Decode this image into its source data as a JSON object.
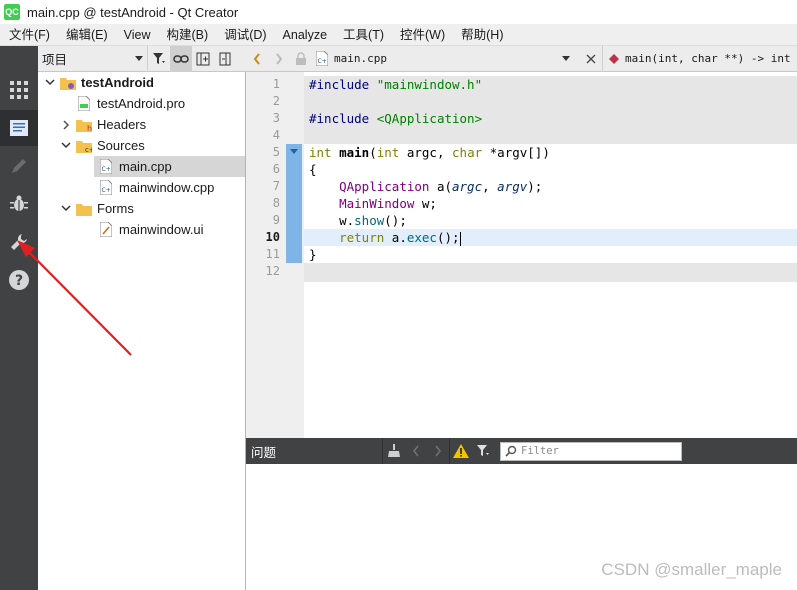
{
  "window": {
    "logo_text": "QC",
    "title": "main.cpp @ testAndroid - Qt Creator"
  },
  "menubar": [
    "文件(F)",
    "编辑(E)",
    "View",
    "构建(B)",
    "调试(D)",
    "Analyze",
    "工具(T)",
    "控件(W)",
    "帮助(H)"
  ],
  "modes": [
    "welcome-grid-icon",
    "edit-document-icon",
    "design-pencil-icon",
    "debug-bug-icon",
    "projects-wrench-icon",
    "help-question-icon"
  ],
  "project_pane": {
    "combo_label": "项目",
    "tree": [
      {
        "label": "testAndroid",
        "bold": true,
        "arrow": "down",
        "icon": "project-folder-icon",
        "depth": 0
      },
      {
        "label": "testAndroid.pro",
        "bold": false,
        "arrow": "",
        "icon": "pro-file-icon",
        "depth": 1
      },
      {
        "label": "Headers",
        "bold": false,
        "arrow": "right",
        "icon": "headers-folder-icon",
        "depth": 1
      },
      {
        "label": "Sources",
        "bold": false,
        "arrow": "down",
        "icon": "sources-folder-icon",
        "depth": 1
      },
      {
        "label": "main.cpp",
        "bold": false,
        "arrow": "",
        "icon": "cpp-file-icon",
        "depth": 2,
        "selected": true
      },
      {
        "label": "mainwindow.cpp",
        "bold": false,
        "arrow": "",
        "icon": "cpp-file-icon",
        "depth": 2
      },
      {
        "label": "Forms",
        "bold": false,
        "arrow": "down",
        "icon": "forms-folder-icon",
        "depth": 1
      },
      {
        "label": "mainwindow.ui",
        "bold": false,
        "arrow": "",
        "icon": "ui-file-icon",
        "depth": 2
      }
    ]
  },
  "editor": {
    "file_name": "main.cpp",
    "symbol": "main(int, char **) -> int",
    "current_line": 10,
    "line_numbers": [
      "1",
      "2",
      "3",
      "4",
      "5",
      "6",
      "7",
      "8",
      "9",
      "10",
      "11",
      "12"
    ],
    "code": [
      "#include \"mainwindow.h\"",
      "",
      "#include <QApplication>",
      "",
      "int main(int argc, char *argv[])",
      "{",
      "    QApplication a(argc, argv);",
      "    MainWindow w;",
      "    w.show();",
      "    return a.exec();",
      "}",
      ""
    ]
  },
  "issues": {
    "title": "问题",
    "filter_placeholder": "Filter"
  },
  "watermark": "CSDN @smaller_maple",
  "colors": {
    "modebar": "#404244",
    "fold_marker": "#7fb4e6",
    "annotation_arrow": "#e02020",
    "keyword": "#808000",
    "string": "#008000"
  }
}
